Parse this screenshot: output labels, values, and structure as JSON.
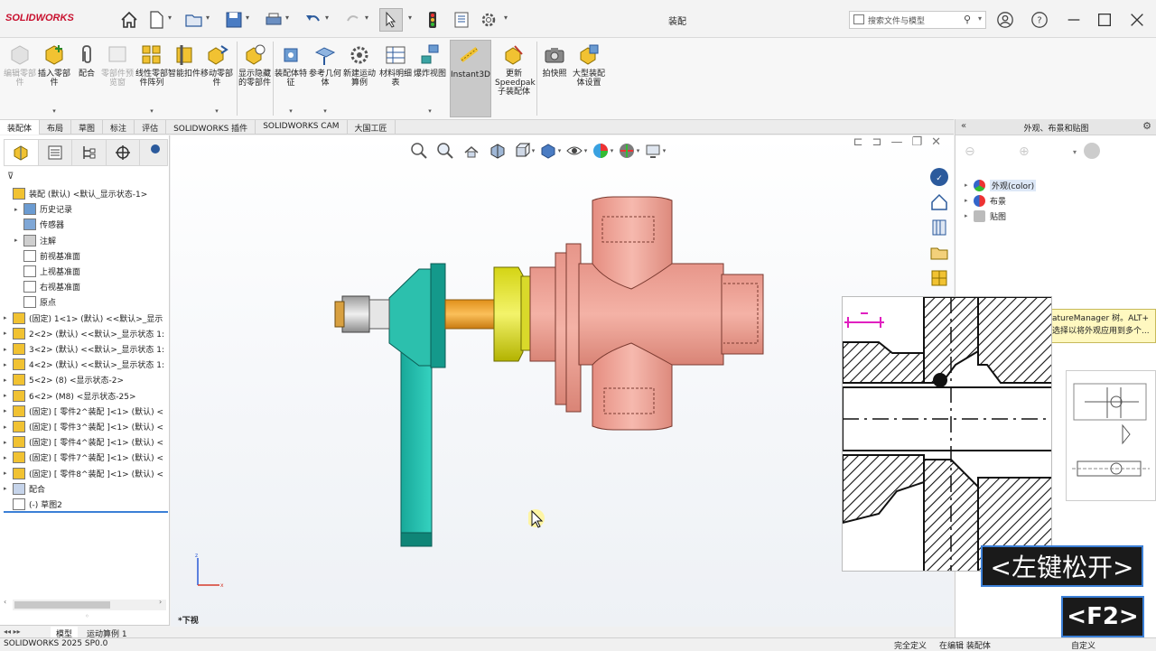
{
  "app": {
    "brand": "SOLIDWORKS",
    "doc_title": "装配"
  },
  "quick_access": [
    "home-icon",
    "new-icon",
    "open-icon",
    "save-icon",
    "print-icon",
    "undo-icon",
    "redo-icon",
    "select-icon",
    "rebuild-icon",
    "file-props-icon",
    "options-icon"
  ],
  "search": {
    "placeholder": "搜索文件与模型"
  },
  "ribbon": {
    "buttons": [
      {
        "label": "编辑零部件",
        "disabled": true
      },
      {
        "label": "插入零部件",
        "disabled": false
      },
      {
        "label": "配合",
        "disabled": false
      },
      {
        "label": "零部件预览窗",
        "disabled": true
      },
      {
        "label": "线性零部件阵列",
        "disabled": false
      },
      {
        "label": "智能扣件",
        "disabled": false
      },
      {
        "label": "移动零部件",
        "disabled": false
      },
      {
        "label": "显示隐藏的零部件",
        "disabled": false
      },
      {
        "label": "装配体特征",
        "disabled": false
      },
      {
        "label": "参考几何体",
        "disabled": false
      },
      {
        "label": "新建运动算例",
        "disabled": false
      },
      {
        "label": "材料明细表",
        "disabled": false
      },
      {
        "label": "爆炸视图",
        "disabled": false
      },
      {
        "label": "Instant3D",
        "disabled": false,
        "active": true
      },
      {
        "label": "更新Speedpak子装配体",
        "disabled": false
      },
      {
        "label": "拍快照",
        "disabled": false
      },
      {
        "label": "大型装配体设置",
        "disabled": false
      }
    ]
  },
  "tabs": [
    "装配体",
    "布局",
    "草图",
    "标注",
    "评估",
    "SOLIDWORKS 插件",
    "SOLIDWORKS CAM",
    "大国工匠"
  ],
  "tree": {
    "items": [
      {
        "label": "装配 (默认) <默认_显示状态-1>",
        "level": 0,
        "expand": "",
        "icon": "assembly"
      },
      {
        "label": "历史记录",
        "level": 1,
        "expand": "▸",
        "icon": "history"
      },
      {
        "label": "传感器",
        "level": 1,
        "expand": "",
        "icon": "sensor"
      },
      {
        "label": "注解",
        "level": 1,
        "expand": "▸",
        "icon": "annotation"
      },
      {
        "label": "前视基准面",
        "level": 1,
        "expand": "",
        "icon": "plane"
      },
      {
        "label": "上视基准面",
        "level": 1,
        "expand": "",
        "icon": "plane"
      },
      {
        "label": "右视基准面",
        "level": 1,
        "expand": "",
        "icon": "plane"
      },
      {
        "label": "原点",
        "level": 1,
        "expand": "",
        "icon": "origin"
      },
      {
        "label": "(固定) 1<1> (默认) <<默认>_显示",
        "level": 0,
        "expand": "▸",
        "icon": "part"
      },
      {
        "label": "2<2> (默认) <<默认>_显示状态 1:",
        "level": 0,
        "expand": "▸",
        "icon": "part"
      },
      {
        "label": "3<2> (默认) <<默认>_显示状态 1:",
        "level": 0,
        "expand": "▸",
        "icon": "part"
      },
      {
        "label": "4<2> (默认) <<默认>_显示状态 1:",
        "level": 0,
        "expand": "▸",
        "icon": "part"
      },
      {
        "label": "5<2> (8) <显示状态-2>",
        "level": 0,
        "expand": "▸",
        "icon": "part"
      },
      {
        "label": "6<2> (M8) <显示状态-25>",
        "level": 0,
        "expand": "▸",
        "icon": "part"
      },
      {
        "label": "(固定) [ 零件2^装配 ]<1> (默认) <",
        "level": 0,
        "expand": "▸",
        "icon": "part"
      },
      {
        "label": "(固定) [ 零件3^装配 ]<1> (默认) <",
        "level": 0,
        "expand": "▸",
        "icon": "part"
      },
      {
        "label": "(固定) [ 零件4^装配 ]<1> (默认) <",
        "level": 0,
        "expand": "▸",
        "icon": "part"
      },
      {
        "label": "(固定) [ 零件7^装配 ]<1> (默认) <",
        "level": 0,
        "expand": "▸",
        "icon": "part"
      },
      {
        "label": "(固定) [ 零件8^装配 ]<1> (默认) <",
        "level": 0,
        "expand": "▸",
        "icon": "part"
      },
      {
        "label": "配合",
        "level": 0,
        "expand": "▸",
        "icon": "mate"
      },
      {
        "label": "(-) 草图2",
        "level": 0,
        "expand": "",
        "icon": "sketch"
      }
    ]
  },
  "bottom_tabs": [
    "模型",
    "运动算例 1"
  ],
  "viewport": {
    "view_label": "*下视"
  },
  "task_pane": {
    "title": "外观、布景和贴图",
    "items": [
      "外观(color)",
      "布景",
      "贴图"
    ]
  },
  "tooltip": {
    "line1": "atureManager 树。ALT+",
    "line2": "选择以将外观应用到多个..."
  },
  "keys": {
    "k1": "<左键松开>",
    "k2": "<F2>"
  },
  "status": {
    "left": "SOLIDWORKS 2025 SP0.0",
    "r1": "完全定义",
    "r2": "在编辑 装配体",
    "r3": "自定义"
  }
}
